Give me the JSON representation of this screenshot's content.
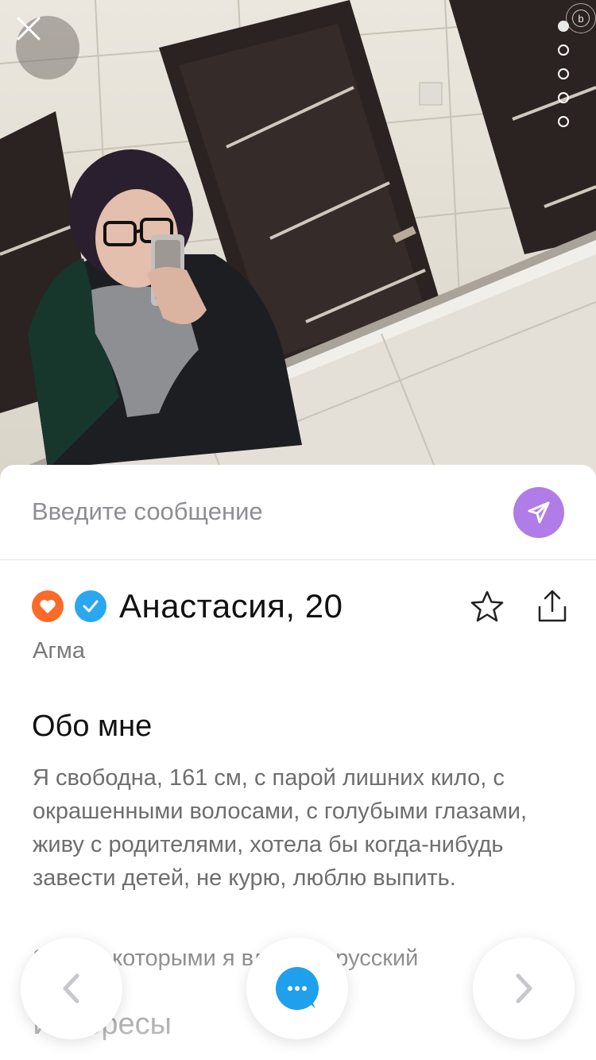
{
  "photo": {
    "description_icon": "profile-photo",
    "page_count": 5,
    "active_page": 1
  },
  "message": {
    "placeholder": "Введите сообщение"
  },
  "profile": {
    "name_age": "Анастасия, 20",
    "location": "Агма"
  },
  "about": {
    "title": "Обо мне",
    "text": "Я свободна, 161 см, с парой лишних кило, с окрашенными волосами, с голубыми глазами, живу с родителями, хотела бы когда-нибудь завести детей, не курю, люблю выпить."
  },
  "languages": {
    "text": "Языки, которыми я владею: русский"
  },
  "interests": {
    "title": "Интересы"
  },
  "colors": {
    "send_button": "#b07ce8",
    "heart_badge": "#fa6b29",
    "verified_badge": "#2aa7ef",
    "chat_button": "#1fa0ec"
  },
  "icons": {
    "close": "close-icon",
    "send": "send-icon",
    "heart": "heart-icon",
    "verified": "checkmark-icon",
    "favorite": "star-icon",
    "share": "share-icon",
    "previous": "chevron-left-icon",
    "chat": "chat-icon",
    "next": "chevron-right-icon"
  }
}
